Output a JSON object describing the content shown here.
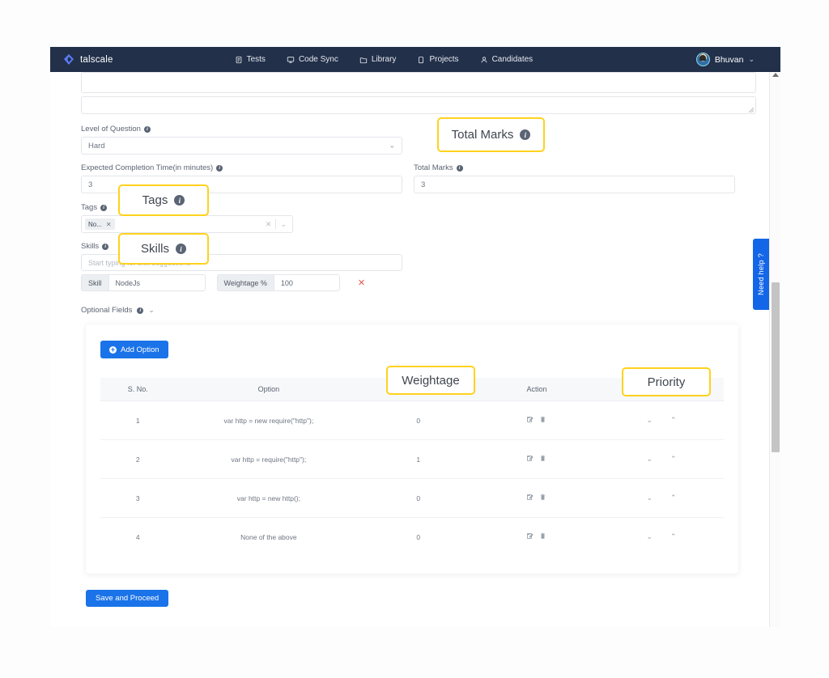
{
  "nav": {
    "brand": "talscale",
    "links": [
      {
        "label": "Tests",
        "icon": "document-icon"
      },
      {
        "label": "Code Sync",
        "icon": "monitor-icon"
      },
      {
        "label": "Library",
        "icon": "folder-icon"
      },
      {
        "label": "Projects",
        "icon": "clipboard-icon"
      },
      {
        "label": "Candidates",
        "icon": "person-icon"
      }
    ],
    "user": "Bhuvan",
    "user_caret": "⌄"
  },
  "side": {
    "need_help": "Need help ?"
  },
  "form": {
    "level_label": "Level of Question",
    "level_value": "Hard",
    "level_caret": "⌄",
    "time_label": "Expected Completion Time(in minutes)",
    "time_value": "3",
    "total_marks_label": "Total Marks",
    "total_marks_value": "3",
    "tags_label": "Tags",
    "tag_chip": "No...",
    "tag_chip_x": "✕",
    "tags_clear": "✕",
    "tags_caret": "⌄",
    "skills_label": "Skills",
    "skills_placeholder": "Start typing for skill suggestions",
    "skill_addon": "Skill",
    "skill_name": "NodeJs",
    "weightage_addon": "Weightage %",
    "weightage_value": "100",
    "skill_remove": "✕",
    "optional_fields_label": "Optional Fields",
    "optional_fields_caret": "⌄"
  },
  "options": {
    "add_button": "Add Option",
    "add_icon": "+",
    "headers": [
      "S. No.",
      "Option",
      "Weightage",
      "Action",
      "Priority"
    ],
    "rows": [
      {
        "sno": "1",
        "option": "var http = new require(\"http\");",
        "weightage": "0",
        "down": "⌄",
        "up": "⌃"
      },
      {
        "sno": "2",
        "option": "var http = require(\"http\");",
        "weightage": "1",
        "down": "⌄",
        "up": "⌃"
      },
      {
        "sno": "3",
        "option": "var http = new http();",
        "weightage": "0",
        "down": "⌄",
        "up": "⌃"
      },
      {
        "sno": "4",
        "option": "None of the above",
        "weightage": "0",
        "down": "⌄",
        "up": "⌃"
      }
    ]
  },
  "footer": {
    "save_label": "Save and Proceed"
  },
  "callouts": [
    {
      "label": "Total Marks",
      "has_info": true
    },
    {
      "label": "Tags",
      "has_info": true
    },
    {
      "label": "Skills",
      "has_info": true
    },
    {
      "label": "Weightage",
      "has_info": false
    },
    {
      "label": "Priority",
      "has_info": false
    }
  ],
  "colors": {
    "navbar": "#22304a",
    "accent": "#1a73e8",
    "callout_border": "#ffd21e",
    "danger": "#e0574d"
  }
}
